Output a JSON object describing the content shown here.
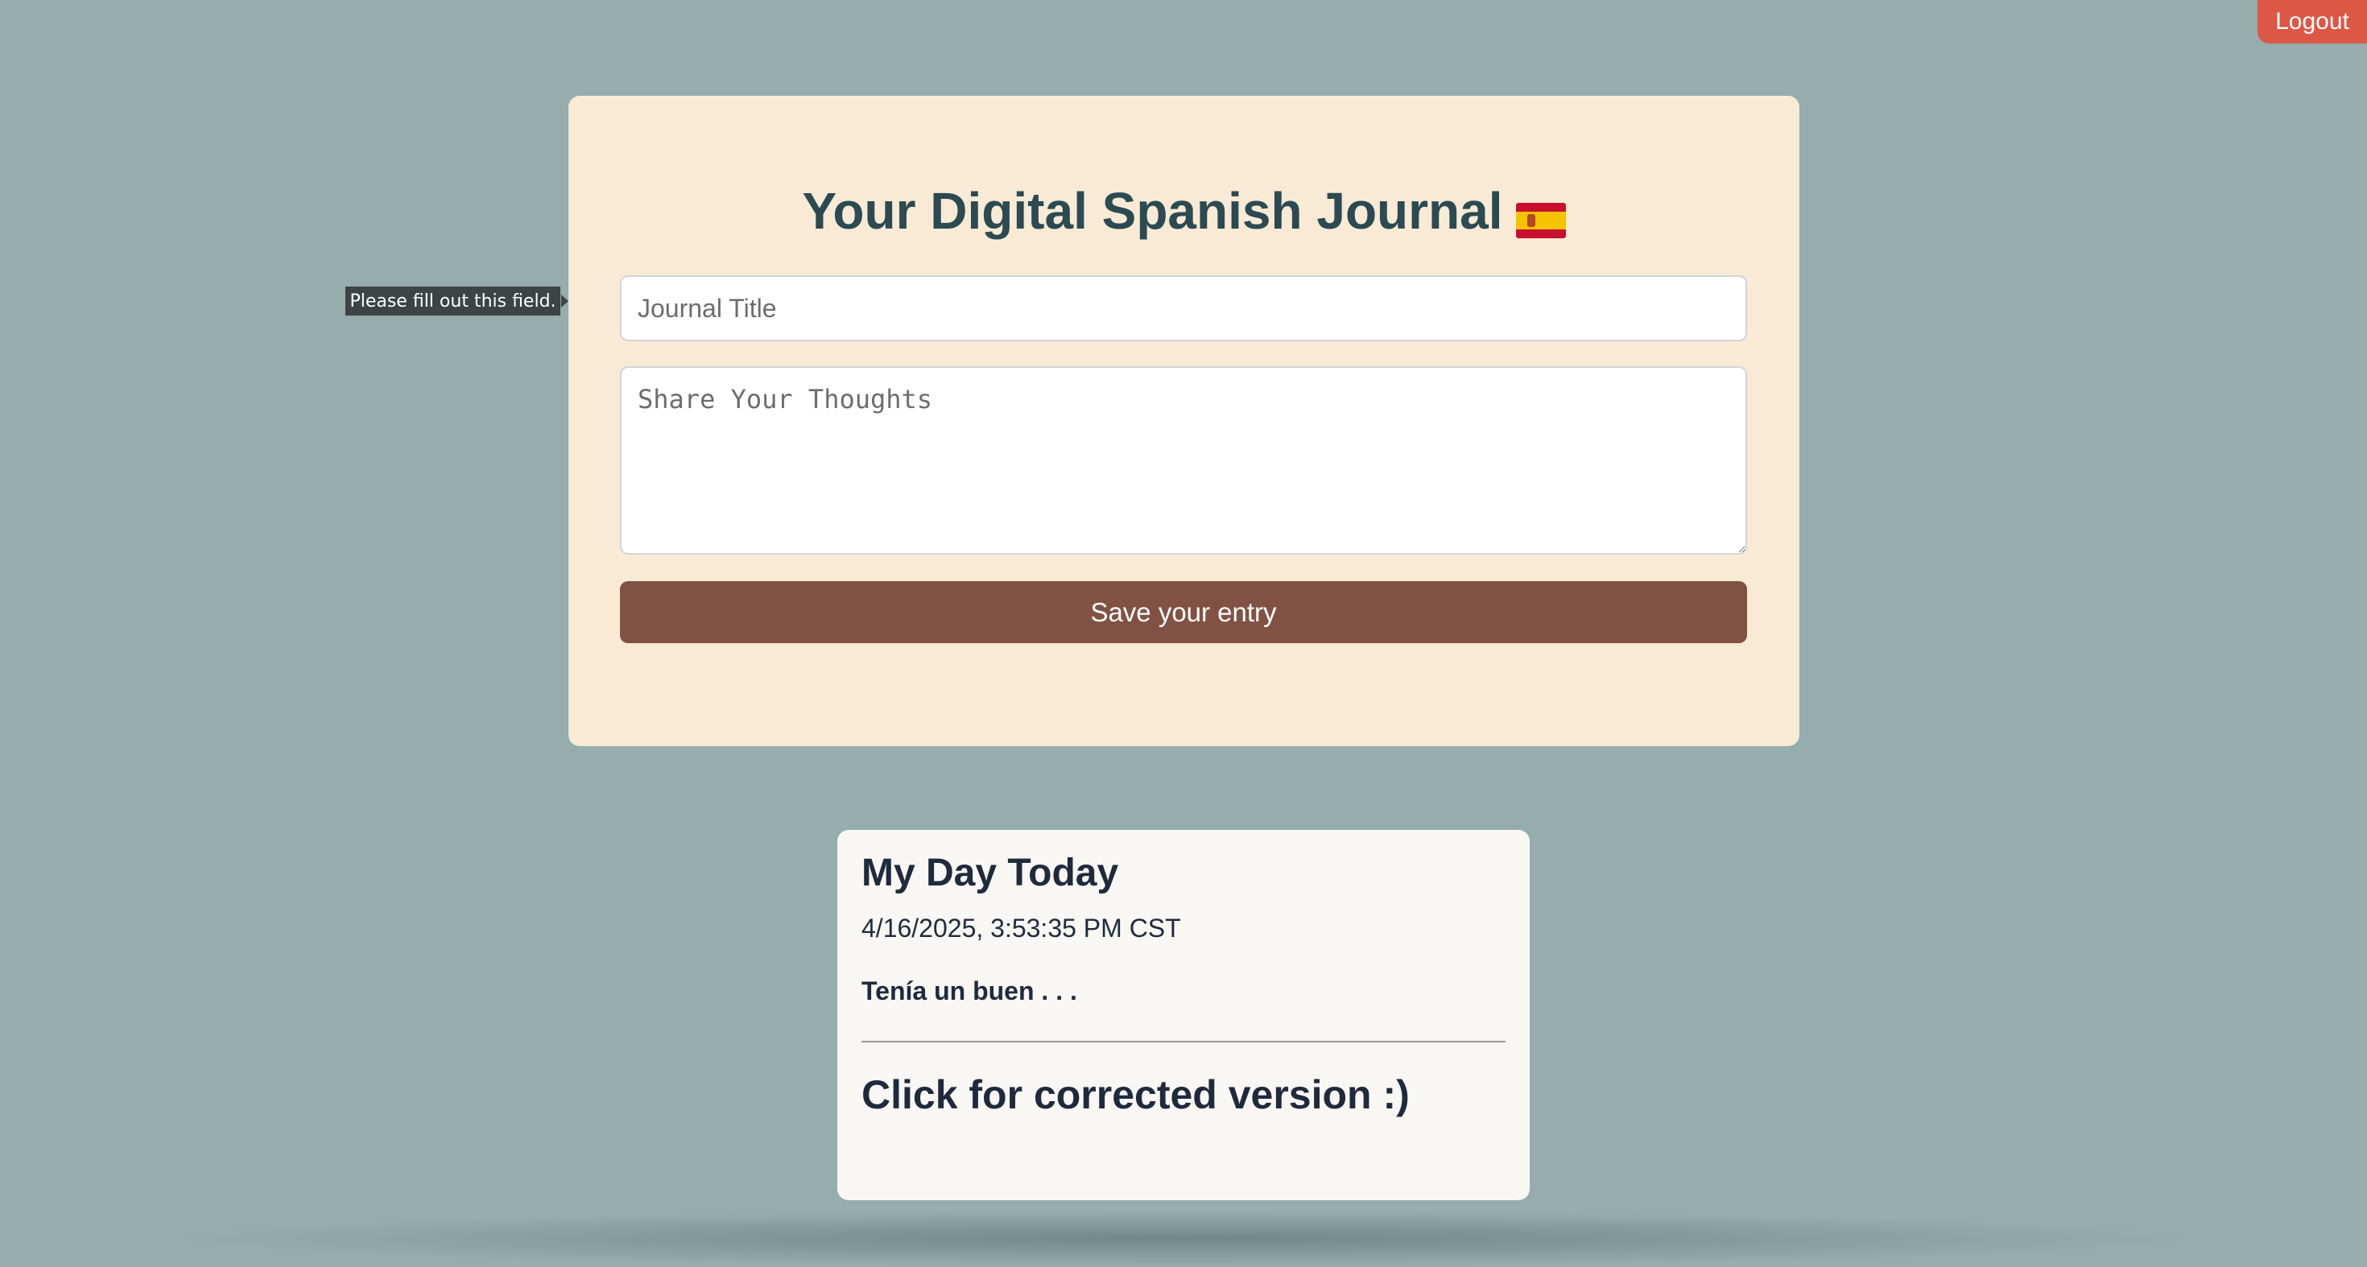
{
  "header": {
    "logout_label": "Logout"
  },
  "journal_form": {
    "heading": "Your Digital Spanish Journal",
    "flag_icon": "spain-flag-icon",
    "title_placeholder": "Journal Title",
    "title_value": "",
    "thoughts_placeholder": "Share Your Thoughts",
    "thoughts_value": "",
    "save_label": "Save your entry",
    "validation_tooltip": "Please fill out this field."
  },
  "entries": [
    {
      "title": "My Day Today",
      "timestamp": "4/16/2025, 3:53:35 PM CST",
      "excerpt": "Tenía un buen . . .",
      "corrected_link": "Click for corrected version :)"
    }
  ],
  "colors": {
    "background": "#95adad",
    "form_card": "#f8ead5",
    "save_button": "#815243",
    "logout_button": "#dd5745",
    "heading_text": "#2b4a52",
    "entry_card": "#f8f7f3"
  }
}
